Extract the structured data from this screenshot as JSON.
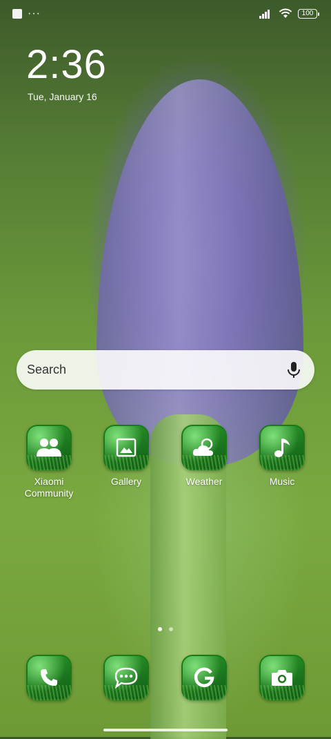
{
  "status_bar": {
    "battery": "100"
  },
  "lockscreen": {
    "time": "2:36",
    "date": "Tue, January 16"
  },
  "search": {
    "label": "Search"
  },
  "home_apps": [
    {
      "label": "Xiaomi Community",
      "icon": "community-icon"
    },
    {
      "label": "Gallery",
      "icon": "gallery-icon"
    },
    {
      "label": "Weather",
      "icon": "weather-icon"
    },
    {
      "label": "Music",
      "icon": "music-icon"
    }
  ],
  "dock_apps": [
    {
      "label": "Phone",
      "icon": "phone-icon"
    },
    {
      "label": "Messages",
      "icon": "messages-icon"
    },
    {
      "label": "Google",
      "icon": "google-icon"
    },
    {
      "label": "Camera",
      "icon": "camera-icon"
    }
  ],
  "pages": {
    "count": 2,
    "current": 1
  },
  "colors": {
    "icon_green": "#1d7a1f",
    "search_bg": "#ffffff"
  }
}
